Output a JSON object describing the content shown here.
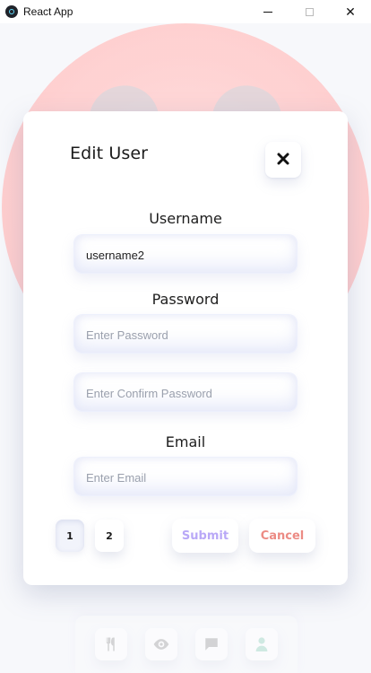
{
  "window": {
    "title": "React App",
    "controls": {
      "minimize_icon": "minimize-icon",
      "maximize_icon": "maximize-icon",
      "close_glyph": "✕"
    }
  },
  "modal": {
    "title": "Edit User",
    "close_glyph": "✖",
    "sections": {
      "username_label": "Username",
      "password_label": "Password",
      "email_label": "Email"
    },
    "fields": {
      "username": {
        "value": "username2",
        "placeholder": ""
      },
      "password": {
        "value": "",
        "placeholder": "Enter Password"
      },
      "confirm_password": {
        "value": "",
        "placeholder": "Enter Confirm Password"
      },
      "email": {
        "value": "",
        "placeholder": "Enter Email"
      }
    },
    "pagination": {
      "page1": "1",
      "page2": "2",
      "active_page": "1"
    },
    "actions": {
      "submit": "Submit",
      "cancel": "Cancel"
    }
  },
  "background": {
    "nav_items": [
      {
        "icon": "utensils-icon"
      },
      {
        "icon": "eye-icon"
      },
      {
        "icon": "chat-icon"
      },
      {
        "icon": "user-icon"
      }
    ]
  },
  "colors": {
    "accent_purple": "#b9a8f7",
    "accent_red": "#ec8b84",
    "icon_gray": "#a7a7a7",
    "icon_mint": "#9ed7c3",
    "bg_pink": "#ffc4c4"
  }
}
